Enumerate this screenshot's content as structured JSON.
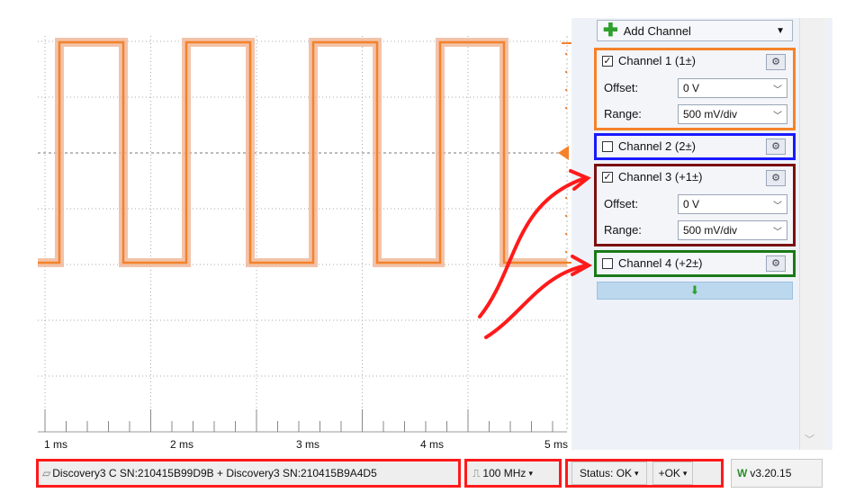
{
  "scope": {
    "time_ticks": [
      "1 ms",
      "2 ms",
      "3 ms",
      "4 ms",
      "5 ms"
    ],
    "trace_color": "#f5822a",
    "high_level_label": "",
    "annotation_color": "#ff1a1a"
  },
  "panel": {
    "add_channel_label": "Add Channel",
    "channels": [
      {
        "label": "Channel 1 (1±)",
        "checked": true,
        "border": "#f5822a",
        "offset_label": "Offset:",
        "offset_value": "0 V",
        "range_label": "Range:",
        "range_value": "500 mV/div"
      },
      {
        "label": "Channel 2 (2±)",
        "checked": false,
        "border": "#1a1aff"
      },
      {
        "label": "Channel 3 (+1±)",
        "checked": true,
        "border": "#7a1010",
        "offset_label": "Offset:",
        "offset_value": "0 V",
        "range_label": "Range:",
        "range_value": "500 mV/div"
      },
      {
        "label": "Channel 4 (+2±)",
        "checked": false,
        "border": "#1a7a1a"
      }
    ],
    "add_bar_icon": "down-arrow-icon"
  },
  "statusbar": {
    "device": "Discovery3 C SN:210415B99D9B + Discovery3 SN:210415B9A4D5",
    "clock": "100 MHz",
    "status": "Status: OK",
    "ok": "+OK",
    "version": "v3.20.15"
  }
}
